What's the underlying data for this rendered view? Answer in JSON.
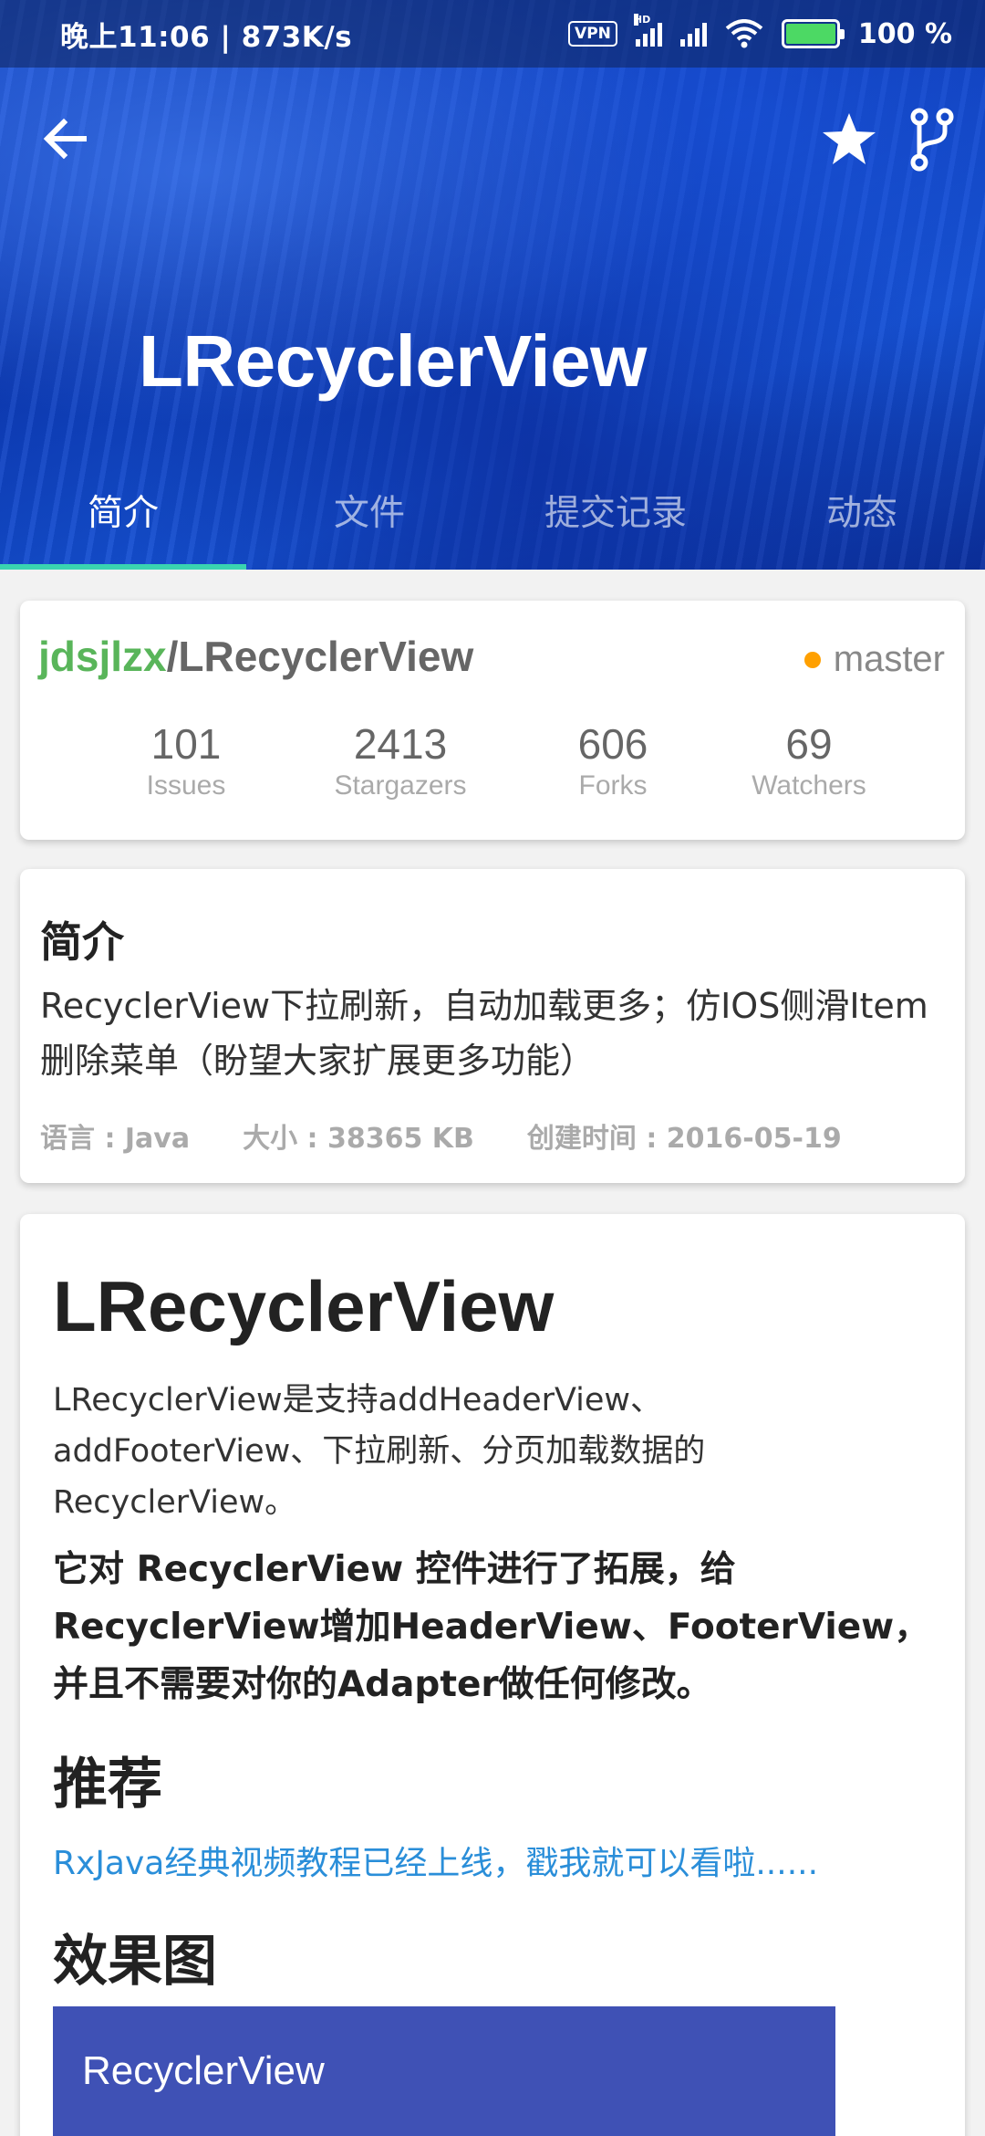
{
  "status_bar": {
    "left": "晚上11:06 | 873K/s",
    "vpn": "VPN",
    "hd": "HD",
    "battery_pct": "100 %",
    "battery_level": 1.0
  },
  "toolbar": {
    "back_icon": "arrow-left-icon",
    "star_icon": "star-icon",
    "fork_icon": "fork-icon"
  },
  "repo": {
    "title": "LRecyclerView"
  },
  "tabs": [
    {
      "label": "简介",
      "active": true
    },
    {
      "label": "文件",
      "active": false
    },
    {
      "label": "提交记录",
      "active": false
    },
    {
      "label": "动态",
      "active": false
    }
  ],
  "info_card": {
    "owner": "jdsjlzx",
    "slash": "/",
    "repo_name": "LRecyclerView",
    "branch": "master",
    "stats": [
      {
        "value": "101",
        "label": "Issues"
      },
      {
        "value": "2413",
        "label": "Stargazers"
      },
      {
        "value": "606",
        "label": "Forks"
      },
      {
        "value": "69",
        "label": "Watchers"
      }
    ]
  },
  "intro_card": {
    "heading": "简介",
    "description": "RecyclerView下拉刷新，自动加载更多；仿IOS侧滑Item删除菜单（盼望大家扩展更多功能）",
    "language": "语言 : Java",
    "size": "大小 : 38365 KB",
    "created": "创建时间 : 2016-05-19"
  },
  "readme": {
    "h1": "LRecyclerView",
    "paragraph": "LRecyclerView是支持addHeaderView、addFooterView、下拉刷新、分页加载数据的RecyclerView。",
    "bold": "它对 RecyclerView 控件进行了拓展，给RecyclerView增加HeaderView、FooterView，并且不需要对你的Adapter做任何修改。",
    "h2_recommend": "推荐",
    "link": "RxJava经典视频教程已经上线，戳我就可以看啦......",
    "h2_demo": "效果图",
    "demo_image_title": "RecyclerView"
  },
  "colors": {
    "header_blue": "#1246c4",
    "tab_indicator": "#3ad4b0",
    "owner_green": "#59b55a",
    "branch_dot": "#ffa000",
    "link_blue": "#2a8ed9",
    "demo_indigo": "#3f51b5"
  }
}
